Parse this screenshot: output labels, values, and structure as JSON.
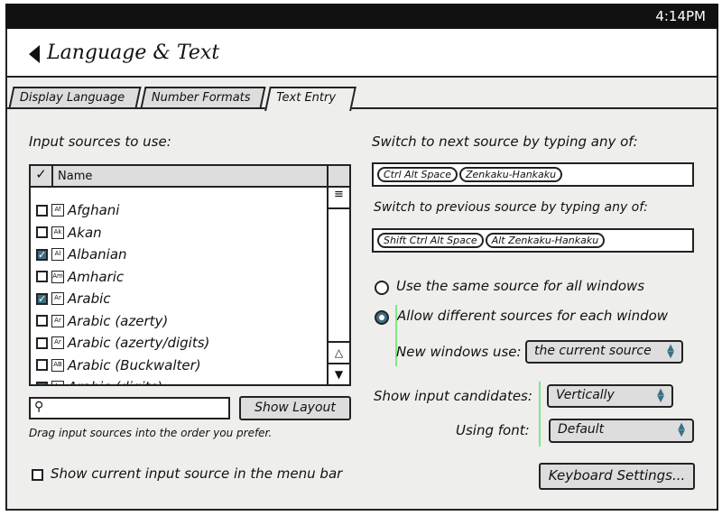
{
  "status": {
    "time": "4:14PM"
  },
  "header": {
    "title": "Language & Text"
  },
  "tabs": [
    {
      "label": "Display Language"
    },
    {
      "label": "Number Formats"
    },
    {
      "label": "Text Entry",
      "active": true
    }
  ],
  "left": {
    "heading": "Input sources to use:",
    "list": {
      "check_header": "✓",
      "name_header": "Name",
      "items": [
        {
          "name": "Afghani",
          "icon": "Af",
          "checked": false
        },
        {
          "name": "Akan",
          "icon": "Ak",
          "checked": false
        },
        {
          "name": "Albanian",
          "icon": "Al",
          "checked": true
        },
        {
          "name": "Amharic",
          "icon": "Am",
          "checked": false
        },
        {
          "name": "Arabic",
          "icon": "Ar",
          "checked": true
        },
        {
          "name": "Arabic (azerty)",
          "icon": "Ar",
          "checked": false
        },
        {
          "name": "Arabic (azerty/digits)",
          "icon": "Ar",
          "checked": false
        },
        {
          "name": "Arabic (Buckwalter)",
          "icon": "AB",
          "checked": false
        },
        {
          "name": "Arabic (digits)",
          "icon": "Ar",
          "checked": true
        }
      ]
    },
    "search": {
      "placeholder": "",
      "value": ""
    },
    "show_layout": "Show Layout",
    "hint": "Drag input sources into the order you prefer.",
    "menu_bar_checkbox": {
      "label": "Show current input source in the menu bar",
      "checked": false
    }
  },
  "right": {
    "next_label": "Switch to next source by typing any of:",
    "next_keys": [
      "Ctrl Alt Space",
      "Zenkaku-Hankaku"
    ],
    "prev_label": "Switch to previous source by typing any of:",
    "prev_keys": [
      "Shift Ctrl Alt Space",
      "Alt Zenkaku-Hankaku"
    ],
    "radio_same": "Use the same source for all windows",
    "radio_different": "Allow different sources for each window",
    "selected_radio": "different",
    "new_windows_label": "New windows use:",
    "new_windows_value": "the current source",
    "candidates_label": "Show input candidates:",
    "candidates_value": "Vertically",
    "font_label": "Using font:",
    "font_value": "Default",
    "keyboard_settings": "Keyboard Settings..."
  },
  "colors": {
    "accent": "#3c6f86",
    "background": "#eeeeec"
  }
}
